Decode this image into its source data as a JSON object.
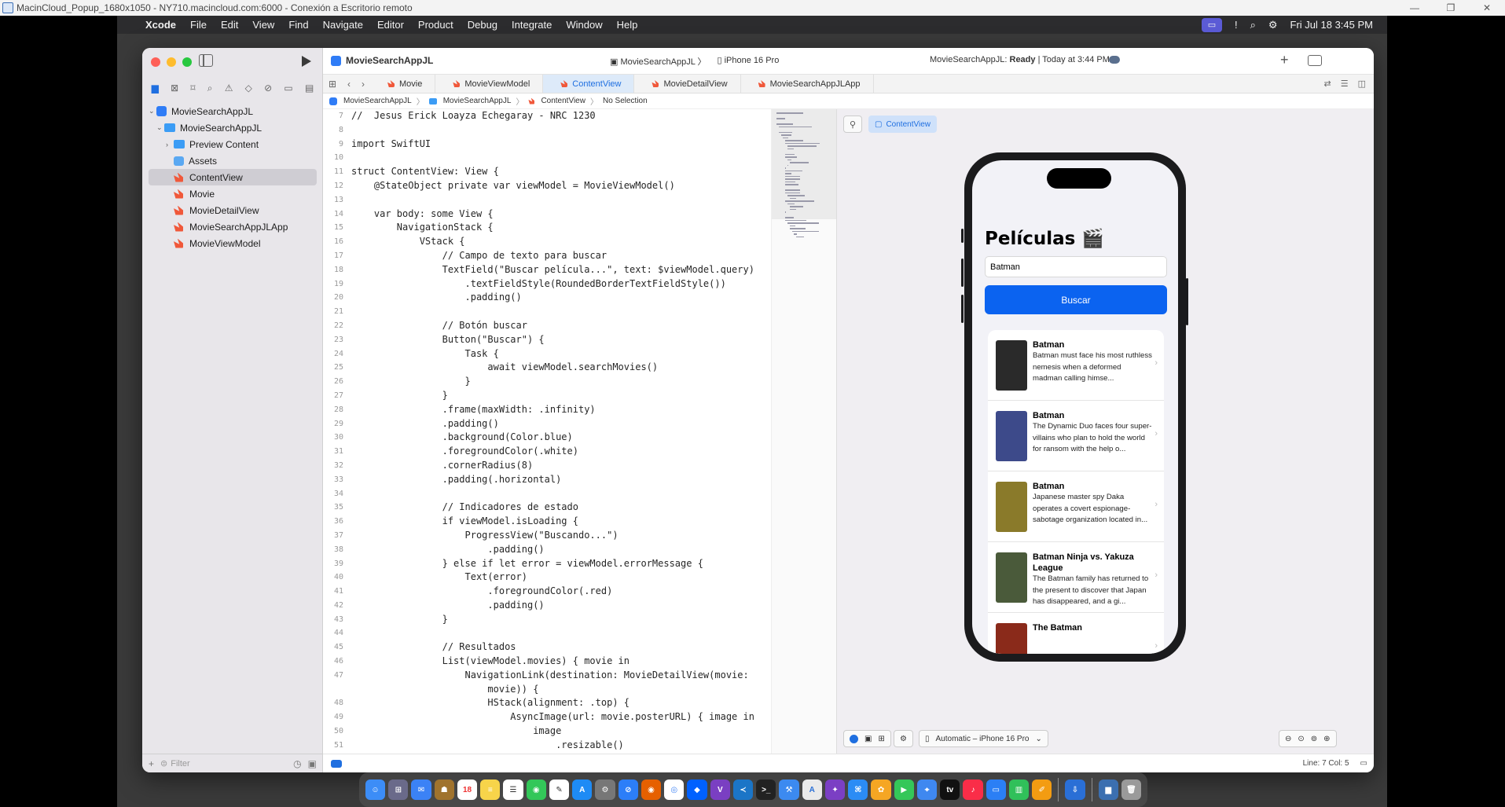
{
  "rdp": {
    "title": "MacinCloud_Popup_1680x1050 - NY710.macincloud.com:6000 - Conexión a Escritorio remoto"
  },
  "menubar": {
    "app": "Xcode",
    "items": [
      "File",
      "Edit",
      "View",
      "Find",
      "Navigate",
      "Editor",
      "Product",
      "Debug",
      "Integrate",
      "Window",
      "Help"
    ],
    "clock": "Fri Jul 18  3:45 PM"
  },
  "toolbar": {
    "project": "MovieSearchAppJL",
    "scheme": "MovieSearchAppJL",
    "device": "iPhone 16 Pro",
    "status_prefix": "MovieSearchAppJL: ",
    "status_state": "Ready",
    "status_time": " | Today at 3:44 PM"
  },
  "navigator": {
    "items": [
      {
        "label": "MovieSearchAppJL",
        "kind": "project"
      },
      {
        "label": "MovieSearchAppJL",
        "kind": "folder"
      },
      {
        "label": "Preview Content",
        "kind": "folder"
      },
      {
        "label": "Assets",
        "kind": "assets"
      },
      {
        "label": "ContentView",
        "kind": "swift"
      },
      {
        "label": "Movie",
        "kind": "swift"
      },
      {
        "label": "MovieDetailView",
        "kind": "swift"
      },
      {
        "label": "MovieSearchAppJLApp",
        "kind": "swift"
      },
      {
        "label": "MovieViewModel",
        "kind": "swift"
      }
    ],
    "filter_placeholder": "Filter"
  },
  "tabs": [
    "Movie",
    "MovieViewModel",
    "ContentView",
    "MovieDetailView",
    "MovieSearchAppJLApp"
  ],
  "breadcrumb": [
    "MovieSearchAppJL",
    "MovieSearchAppJL",
    "ContentView",
    "No Selection"
  ],
  "code": [
    {
      "n": "7",
      "t": "//  Jesus Erick Loayza Echegaray - NRC 1230"
    },
    {
      "n": "8",
      "t": ""
    },
    {
      "n": "9",
      "t": "import SwiftUI"
    },
    {
      "n": "10",
      "t": ""
    },
    {
      "n": "11",
      "t": "struct ContentView: View {"
    },
    {
      "n": "12",
      "t": "    @StateObject private var viewModel = MovieViewModel()"
    },
    {
      "n": "13",
      "t": ""
    },
    {
      "n": "14",
      "t": "    var body: some View {"
    },
    {
      "n": "15",
      "t": "        NavigationStack {"
    },
    {
      "n": "16",
      "t": "            VStack {"
    },
    {
      "n": "17",
      "t": "                // Campo de texto para buscar"
    },
    {
      "n": "18",
      "t": "                TextField(\"Buscar película...\", text: $viewModel.query)"
    },
    {
      "n": "19",
      "t": "                    .textFieldStyle(RoundedBorderTextFieldStyle())"
    },
    {
      "n": "20",
      "t": "                    .padding()"
    },
    {
      "n": "21",
      "t": ""
    },
    {
      "n": "22",
      "t": "                // Botón buscar"
    },
    {
      "n": "23",
      "t": "                Button(\"Buscar\") {"
    },
    {
      "n": "24",
      "t": "                    Task {"
    },
    {
      "n": "25",
      "t": "                        await viewModel.searchMovies()"
    },
    {
      "n": "26",
      "t": "                    }"
    },
    {
      "n": "27",
      "t": "                }"
    },
    {
      "n": "28",
      "t": "                .frame(maxWidth: .infinity)"
    },
    {
      "n": "29",
      "t": "                .padding()"
    },
    {
      "n": "30",
      "t": "                .background(Color.blue)"
    },
    {
      "n": "31",
      "t": "                .foregroundColor(.white)"
    },
    {
      "n": "32",
      "t": "                .cornerRadius(8)"
    },
    {
      "n": "33",
      "t": "                .padding(.horizontal)"
    },
    {
      "n": "34",
      "t": ""
    },
    {
      "n": "35",
      "t": "                // Indicadores de estado"
    },
    {
      "n": "36",
      "t": "                if viewModel.isLoading {"
    },
    {
      "n": "37",
      "t": "                    ProgressView(\"Buscando...\")"
    },
    {
      "n": "38",
      "t": "                        .padding()"
    },
    {
      "n": "39",
      "t": "                } else if let error = viewModel.errorMessage {"
    },
    {
      "n": "40",
      "t": "                    Text(error)"
    },
    {
      "n": "41",
      "t": "                        .foregroundColor(.red)"
    },
    {
      "n": "42",
      "t": "                        .padding()"
    },
    {
      "n": "43",
      "t": "                }"
    },
    {
      "n": "44",
      "t": ""
    },
    {
      "n": "45",
      "t": "                // Resultados"
    },
    {
      "n": "46",
      "t": "                List(viewModel.movies) { movie in"
    },
    {
      "n": "47",
      "t": "                    NavigationLink(destination: MovieDetailView(movie:"
    },
    {
      "n": "",
      "t": "                        movie)) {"
    },
    {
      "n": "48",
      "t": "                        HStack(alignment: .top) {"
    },
    {
      "n": "49",
      "t": "                            AsyncImage(url: movie.posterURL) { image in"
    },
    {
      "n": "50",
      "t": "                                image"
    },
    {
      "n": "51",
      "t": "                                    .resizable()"
    }
  ],
  "preview": {
    "chip": "ContentView",
    "nav_title": "Películas 🎬",
    "search_value": "Batman",
    "button": "Buscar",
    "movies": [
      {
        "title": "Batman",
        "desc": "Batman must face his most ruthless nemesis when a deformed madman calling himse...",
        "poster_color": "#2a2a2a"
      },
      {
        "title": "Batman",
        "desc": "The Dynamic Duo faces four super-villains who plan to hold the world for ransom with the help o...",
        "poster_color": "#3d4a8a"
      },
      {
        "title": "Batman",
        "desc": "Japanese master spy Daka operates a covert espionage-sabotage organization located in...",
        "poster_color": "#8a7a2a"
      },
      {
        "title": "Batman Ninja vs. Yakuza League",
        "desc": "The Batman family has returned to the present to discover that Japan has disappeared, and a gi...",
        "poster_color": "#4a5a3a"
      },
      {
        "title": "The Batman",
        "desc": "",
        "poster_color": "#8a2a1a"
      }
    ],
    "device_picker": "Automatic – iPhone 16 Pro"
  },
  "statusbar": {
    "position": "Line: 7  Col: 5"
  }
}
